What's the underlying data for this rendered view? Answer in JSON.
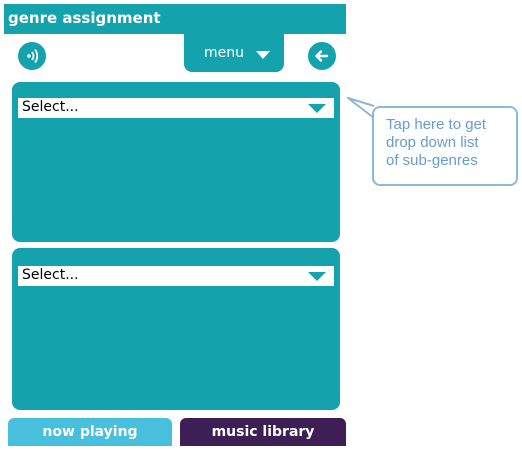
{
  "window": {
    "title": "genre assignment"
  },
  "toolbar": {
    "sound_icon": "sound-waves-icon",
    "menu_label": "menu",
    "menu_caret_icon": "caret-down-icon",
    "back_icon": "arrow-left-icon"
  },
  "panels": [
    {
      "select_value": "Select..."
    },
    {
      "select_value": "Select..."
    }
  ],
  "bottom_tabs": {
    "now_playing": "now playing",
    "music_library": "music library"
  },
  "callout": {
    "lines": [
      "Tap here to get",
      "drop down list",
      "of sub-genres"
    ]
  },
  "colors": {
    "accent": "#14a3ad",
    "now_playing_tab": "#48c0dd",
    "music_library_tab": "#3d1f56",
    "callout_border": "#8fb7d6",
    "callout_text": "#6a9cc9"
  }
}
